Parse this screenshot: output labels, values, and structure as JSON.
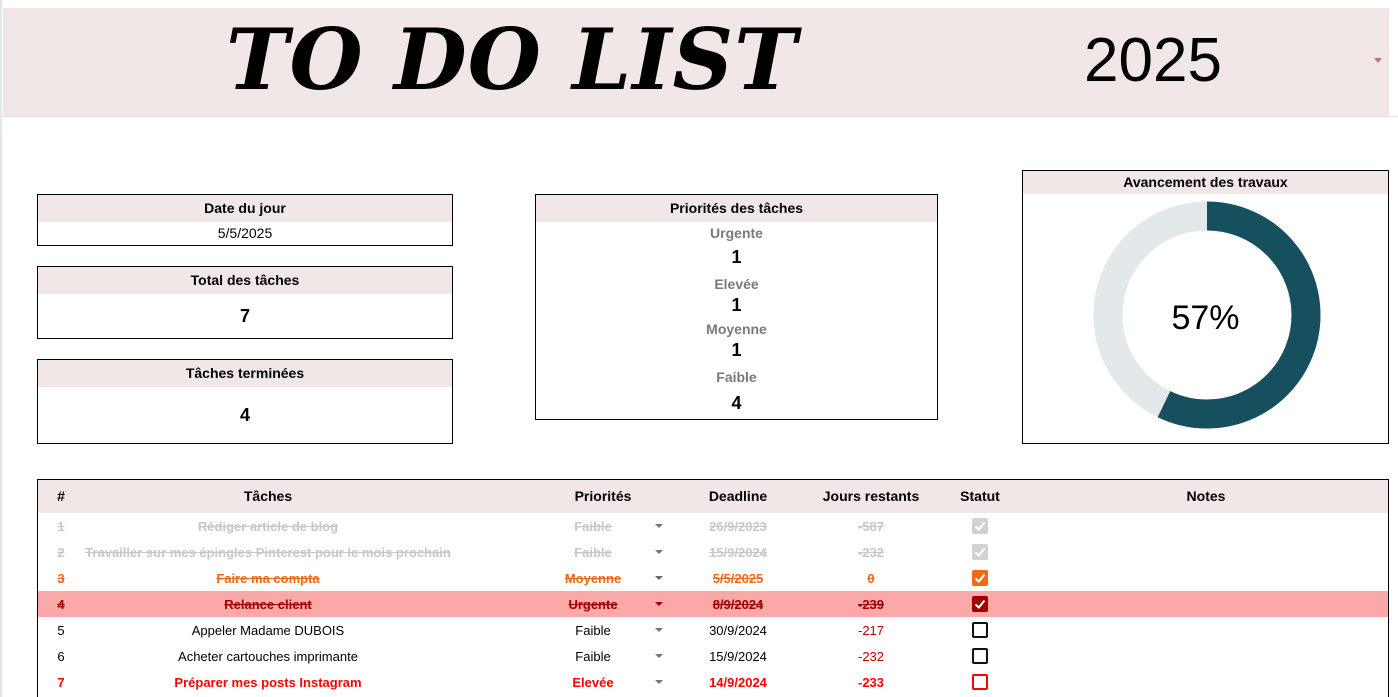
{
  "header": {
    "title": "TO DO LIST",
    "year": "2025"
  },
  "date_card": {
    "label": "Date du jour",
    "value": "5/5/2025"
  },
  "total_card": {
    "label": "Total des tâches",
    "value": "7"
  },
  "done_card": {
    "label": "Tâches terminées",
    "value": "4"
  },
  "priorities": {
    "title": "Priorités des tâches",
    "items": [
      {
        "label": "Urgente",
        "count": "1"
      },
      {
        "label": "Elevée",
        "count": "1"
      },
      {
        "label": "Moyenne",
        "count": "1"
      },
      {
        "label": "Faible",
        "count": "4"
      }
    ]
  },
  "progress": {
    "title": "Avancement des travaux",
    "percent_label": "57%",
    "fraction": 0.5714,
    "fill_color": "#16505e",
    "track_color": "#e3e8ea"
  },
  "table": {
    "headers": {
      "num": "#",
      "task": "Tâches",
      "priority": "Priorités",
      "deadline": "Deadline",
      "days": "Jours restants",
      "status": "Statut",
      "notes": "Notes"
    },
    "rows": [
      {
        "num": "1",
        "task": "Rédiger article de blog",
        "priority": "Faible",
        "deadline": "26/9/2023",
        "days": "-587",
        "done": true,
        "style": "gray"
      },
      {
        "num": "2",
        "task": "Travailler sur mes épingles Pinterest pour le mois prochain",
        "priority": "Faible",
        "deadline": "15/9/2024",
        "days": "-232",
        "done": true,
        "style": "gray"
      },
      {
        "num": "3",
        "task": "Faire ma compta",
        "priority": "Moyenne",
        "deadline": "5/5/2025",
        "days": "0",
        "done": true,
        "style": "orange"
      },
      {
        "num": "4",
        "task": "Relance client",
        "priority": "Urgente",
        "deadline": "8/9/2024",
        "days": "-239",
        "done": true,
        "style": "red"
      },
      {
        "num": "5",
        "task": "Appeler Madame DUBOIS",
        "priority": "Faible",
        "deadline": "30/9/2024",
        "days": "-217",
        "done": false,
        "style": "normal"
      },
      {
        "num": "6",
        "task": "Acheter cartouches imprimante",
        "priority": "Faible",
        "deadline": "15/9/2024",
        "days": "-232",
        "done": false,
        "style": "normal"
      },
      {
        "num": "7",
        "task": "Préparer mes posts Instagram",
        "priority": "Elevée",
        "deadline": "14/9/2024",
        "days": "-233",
        "done": false,
        "style": "redtext"
      }
    ]
  },
  "colors": {
    "band": "#f0e7e6",
    "gray_done": "#c8c8c8",
    "orange_done": "#ef6a15",
    "urgent_row_bg": "#fba8a8",
    "urgent_text": "#a00000",
    "high_text": "#ff0000"
  }
}
